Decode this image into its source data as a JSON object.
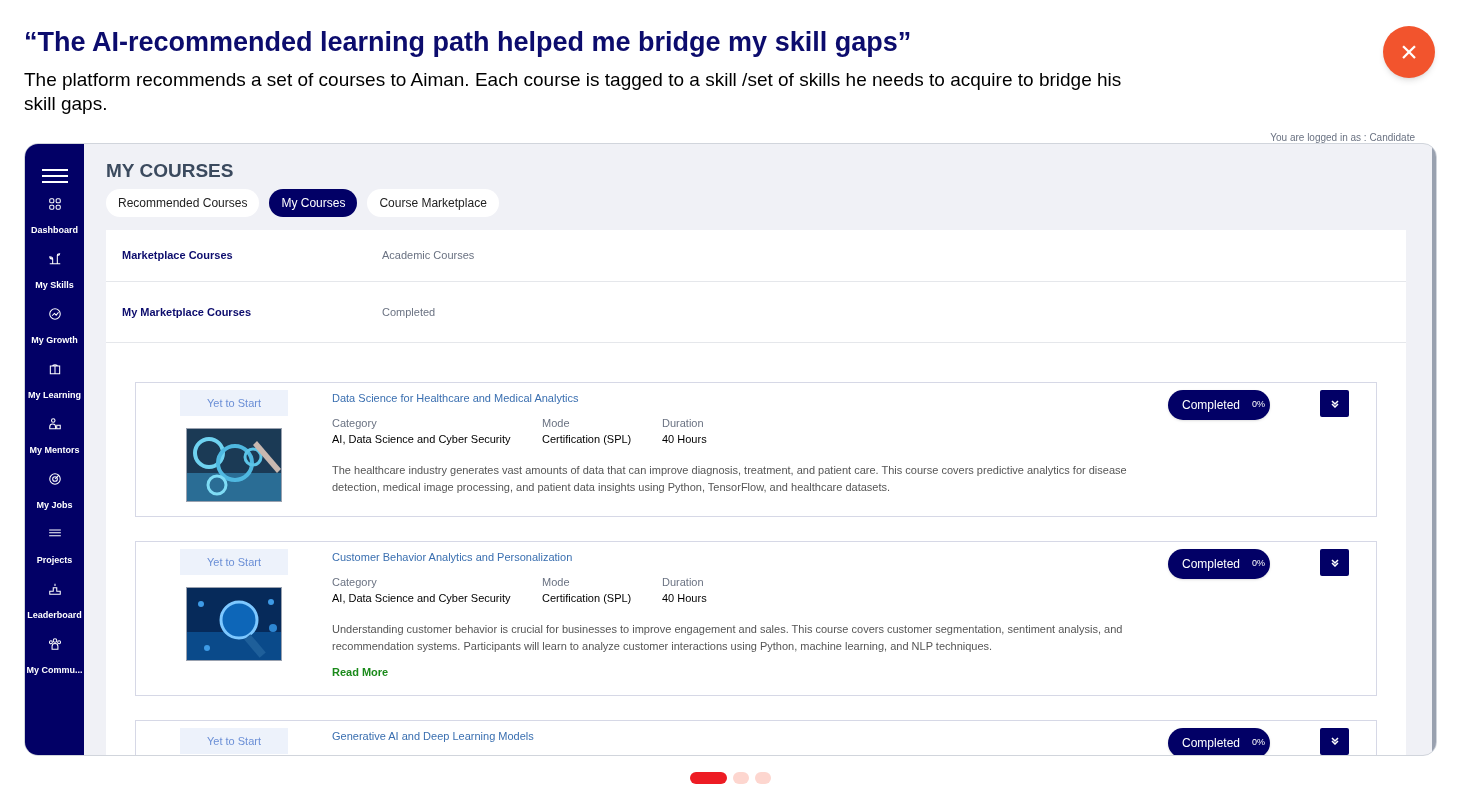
{
  "header": {
    "title": "“The AI-recommended learning path helped me bridge my skill gaps”",
    "description": "The platform recommends a set of courses to Aiman. Each course is tagged to a skill /set of skills he needs to acquire to bridge his skill gaps."
  },
  "close_button": {
    "label": "×"
  },
  "app": {
    "login_note": "You are logged in as : Candidate",
    "sidebar": {
      "items": [
        {
          "label": "Dashboard",
          "kind": "grid"
        },
        {
          "label": "My Skills",
          "kind": "plant"
        },
        {
          "label": "My Growth",
          "kind": "chart"
        },
        {
          "label": "My Learning",
          "kind": "book"
        },
        {
          "label": "My Mentors",
          "kind": "people"
        },
        {
          "label": "My Jobs",
          "kind": "target"
        },
        {
          "label": "Projects",
          "kind": "stack"
        },
        {
          "label": "Leaderboard",
          "kind": "podium"
        },
        {
          "label": "My Commu...",
          "kind": "group"
        }
      ]
    },
    "page_title": "MY COURSES",
    "tabs": [
      {
        "label": "Recommended Courses",
        "selected": false
      },
      {
        "label": "My Courses",
        "selected": true
      },
      {
        "label": "Course Marketplace",
        "selected": false
      }
    ],
    "filters": [
      {
        "label": "Marketplace Courses",
        "value": "Academic Courses"
      },
      {
        "label": "My Marketplace Courses",
        "value": "Completed"
      }
    ],
    "courses": [
      {
        "status": "Yet to Start",
        "title": "Data Science for Healthcare and Medical Analytics",
        "fields": [
          {
            "label": "Category",
            "value": "AI, Data Science and Cyber Security"
          },
          {
            "label": "Mode",
            "value": "Certification (SPL)"
          },
          {
            "label": "Duration",
            "value": "40 Hours"
          }
        ],
        "description": "The healthcare industry generates vast amounts of data that can improve diagnosis, treatment, and patient care. This course covers predictive analytics for disease detection, medical image processing, and patient data insights using Python, TensorFlow, and healthcare datasets.",
        "badge": "Completed",
        "percent": "0%"
      },
      {
        "status": "Yet to Start",
        "title": "Customer Behavior Analytics and Personalization",
        "fields": [
          {
            "label": "Category",
            "value": "AI, Data Science and Cyber Security"
          },
          {
            "label": "Mode",
            "value": "Certification (SPL)"
          },
          {
            "label": "Duration",
            "value": "40 Hours"
          }
        ],
        "description": "Understanding customer behavior is crucial for businesses to improve engagement and sales. This course covers customer segmentation, sentiment analysis, and recommendation systems. Participants will learn to analyze customer interactions using Python, machine learning, and NLP techniques.",
        "read_more": "Read More",
        "badge": "Completed",
        "percent": "0%"
      },
      {
        "status": "Yet to Start",
        "title": "Generative AI and Deep Learning Models",
        "badge": "Completed",
        "percent": "0%"
      }
    ]
  },
  "pagination": [
    {
      "selected": true
    },
    {
      "selected": false
    },
    {
      "selected": false
    }
  ]
}
